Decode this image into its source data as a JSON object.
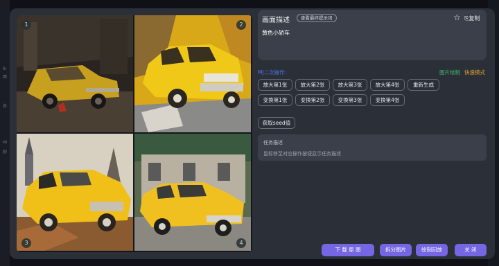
{
  "image_grid": {
    "cells": [
      {
        "index": "1"
      },
      {
        "index": "2"
      },
      {
        "index": "3"
      },
      {
        "index": "4"
      }
    ]
  },
  "description": {
    "title": "画面描述",
    "view_prompt_label": "查看最终提示词",
    "copy_label": "复制",
    "prompt_text": "黄色小轿车"
  },
  "operations": {
    "label": "MJ二次操作：",
    "mode_a": "图片绘制",
    "mode_b": "快速模式",
    "upscale": [
      "放大第1张",
      "放大第2张",
      "放大第3张",
      "放大第4张"
    ],
    "regenerate": "重新生成",
    "variation": [
      "变换第1张",
      "变换第2张",
      "变换第3张",
      "变换第4张"
    ],
    "get_seed": "获取seed值"
  },
  "task": {
    "title": "任务描述",
    "hint": "鼠标移至对应操作按钮显示任务描述"
  },
  "actions": {
    "download": "下 载 原 图",
    "split": "拆分图片",
    "draw_back": "绘制回放",
    "close": "关 闭"
  },
  "colors": {
    "accent": "#7566e4",
    "mj_label": "#4a78e0",
    "mode_a": "#3fb870",
    "mode_b": "#e0a030"
  }
}
